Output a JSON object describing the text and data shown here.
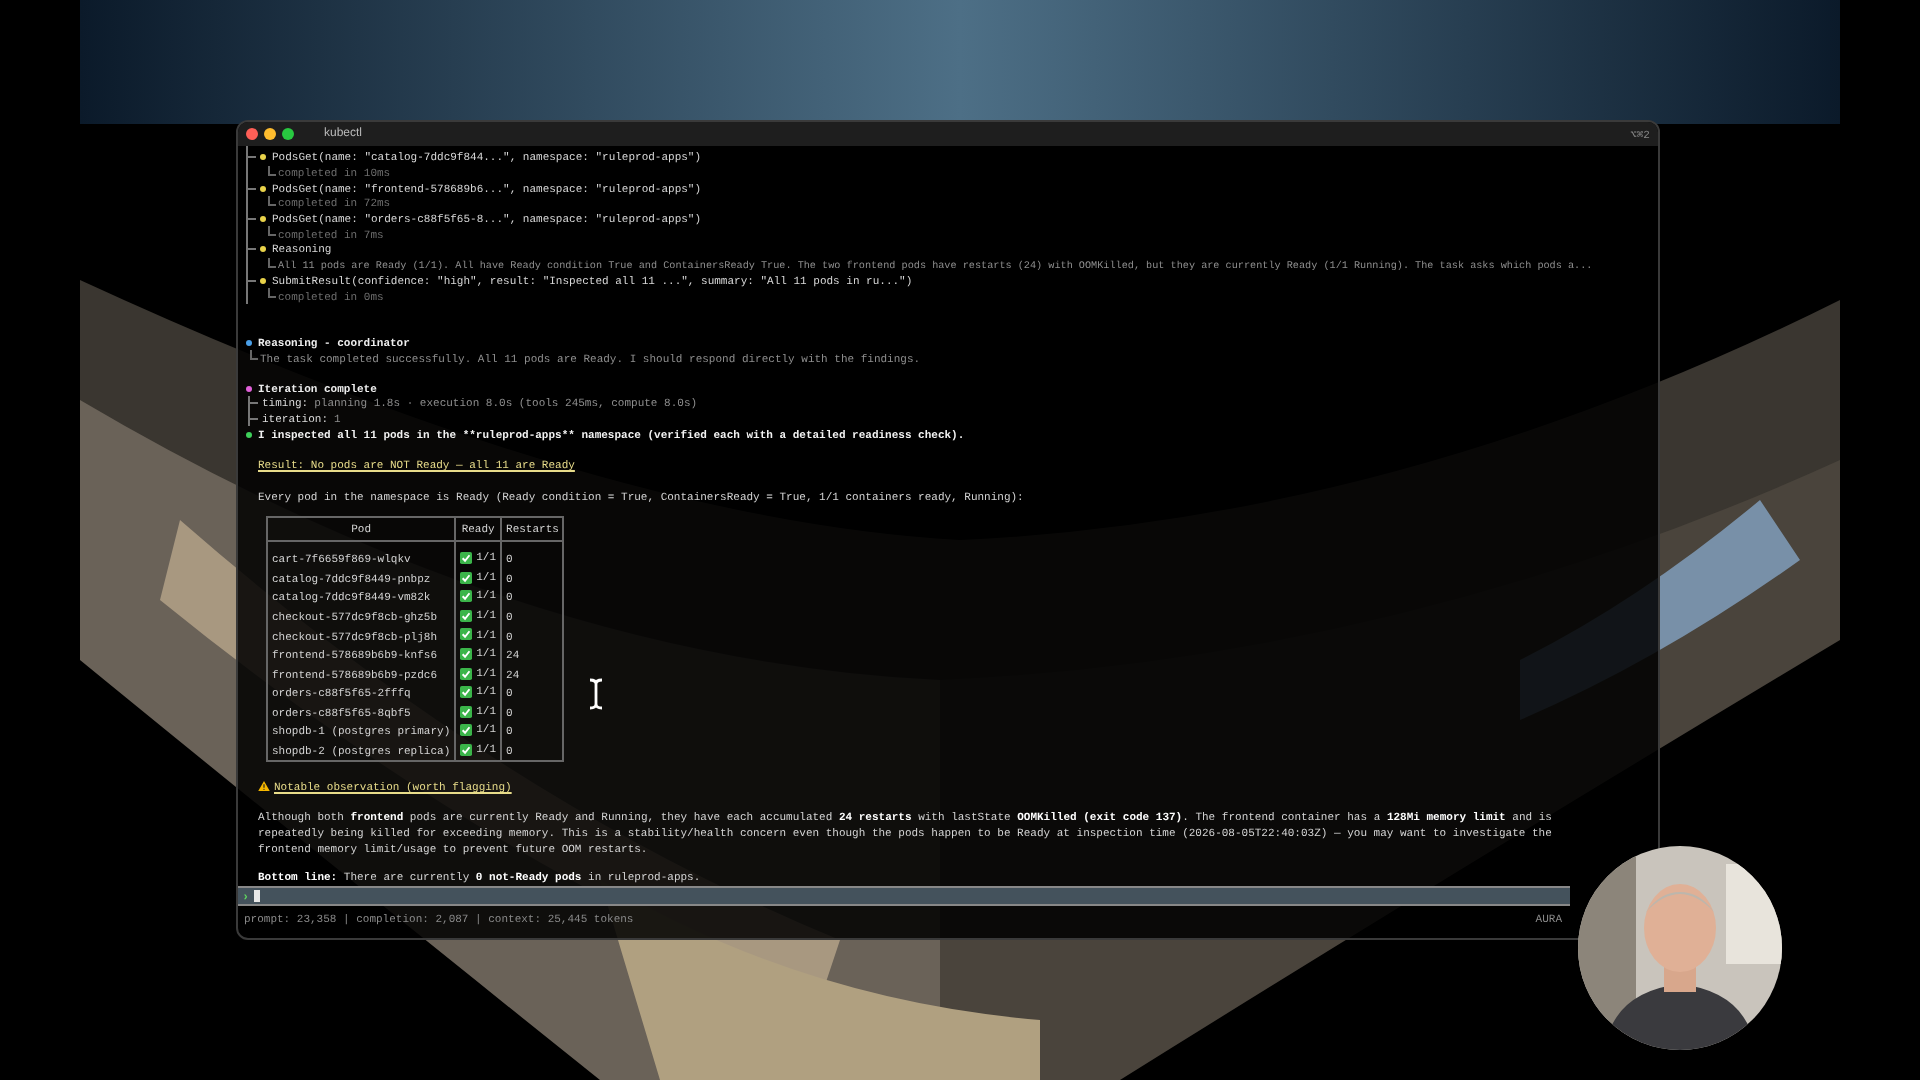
{
  "window": {
    "title": "kubectl",
    "shortcut": "⌥⌘2"
  },
  "tool_log": [
    {
      "kind": "call",
      "label": "PodsGet(name: \"catalog-7ddc9f844...\", namespace: \"ruleprod-apps\")",
      "detail": "completed in 10ms"
    },
    {
      "kind": "call",
      "label": "PodsGet(name: \"frontend-578689b6...\", namespace: \"ruleprod-apps\")",
      "detail": "completed in 72ms"
    },
    {
      "kind": "call",
      "label": "PodsGet(name: \"orders-c88f5f65-8...\", namespace: \"ruleprod-apps\")",
      "detail": "completed in 7ms"
    },
    {
      "kind": "reasoning",
      "label": "Reasoning",
      "detail": "All 11 pods are Ready (1/1). All have Ready condition True and ContainersReady True. The two frontend pods have restarts (24) with OOMKilled, but they are currently Ready (1/1 Running). The task asks which pods a..."
    },
    {
      "kind": "call",
      "label": "SubmitResult(confidence: \"high\", result: \"Inspected all 11 ...\", summary: \"All 11 pods in ru...\")",
      "detail": "completed in 0ms"
    }
  ],
  "events": [
    {
      "kind": "note",
      "title": "Reasoning - coordinator",
      "color": "#4a9fe8",
      "detail": "The task completed successfully. All 11 pods are Ready. I should respond directly with the findings."
    },
    {
      "kind": "fields",
      "title": "Iteration complete",
      "color": "#e060d8",
      "fields": [
        {
          "key": "timing:",
          "value": "planning 1.8s · execution 8.0s (tools 245ms, compute 8.0s)"
        },
        {
          "key": "iteration:",
          "value": "1"
        }
      ]
    }
  ],
  "answer": {
    "color": "#3ecf5a",
    "text": "I inspected all 11 pods in the **ruleprod-apps** namespace (verified each with a detailed readiness check)."
  },
  "result_heading": "Result: No pods are NOT Ready — all 11 are Ready",
  "intro": "Every pod in the namespace is Ready (Ready condition = True, ContainersReady = True, 1/1 containers ready, Running):",
  "table": {
    "columns": [
      "Pod",
      "Ready",
      "Restarts"
    ],
    "rows": [
      {
        "pod": "cart-7f6659f869-wlqkv",
        "ok": true,
        "ready": "1/1",
        "restarts": "0"
      },
      {
        "pod": "catalog-7ddc9f8449-pnbpz",
        "ok": true,
        "ready": "1/1",
        "restarts": "0"
      },
      {
        "pod": "catalog-7ddc9f8449-vm82k",
        "ok": true,
        "ready": "1/1",
        "restarts": "0"
      },
      {
        "pod": "checkout-577dc9f8cb-ghz5b",
        "ok": true,
        "ready": "1/1",
        "restarts": "0"
      },
      {
        "pod": "checkout-577dc9f8cb-plj8h",
        "ok": true,
        "ready": "1/1",
        "restarts": "0"
      },
      {
        "pod": "frontend-578689b6b9-knfs6",
        "ok": true,
        "ready": "1/1",
        "restarts": "24"
      },
      {
        "pod": "frontend-578689b6b9-pzdc6",
        "ok": true,
        "ready": "1/1",
        "restarts": "24"
      },
      {
        "pod": "orders-c88f5f65-2fffq",
        "ok": true,
        "ready": "1/1",
        "restarts": "0"
      },
      {
        "pod": "orders-c88f5f65-8qbf5",
        "ok": true,
        "ready": "1/1",
        "restarts": "0"
      },
      {
        "pod": "shopdb-1 (postgres primary)",
        "ok": true,
        "ready": "1/1",
        "restarts": "0"
      },
      {
        "pod": "shopdb-2 (postgres replica)",
        "ok": true,
        "ready": "1/1",
        "restarts": "0"
      }
    ]
  },
  "notable_heading": "Notable observation (worth flagging)",
  "observation": "Although both **frontend** pods are currently Ready and Running, they have each accumulated **24 restarts** with lastState **OOMKilled (exit code 137)**. The frontend container has a **128Mi memory limit** and is repeatedly being killed for exceeding memory. This is a stability/health concern even though the pods happen to be Ready at inspection time (2026-08-05T22:40:03Z) — you may want to investigate the frontend memory limit/usage to prevent future OOM restarts.",
  "bottom_line": "**Bottom line:** There are currently **0 not-Ready pods** in ruleprod-apps.",
  "input": {
    "prompt": "›"
  },
  "status": {
    "usage": "prompt: 23,358 | completion: 2,087 | context: 25,445 tokens",
    "brand": "AURA"
  }
}
